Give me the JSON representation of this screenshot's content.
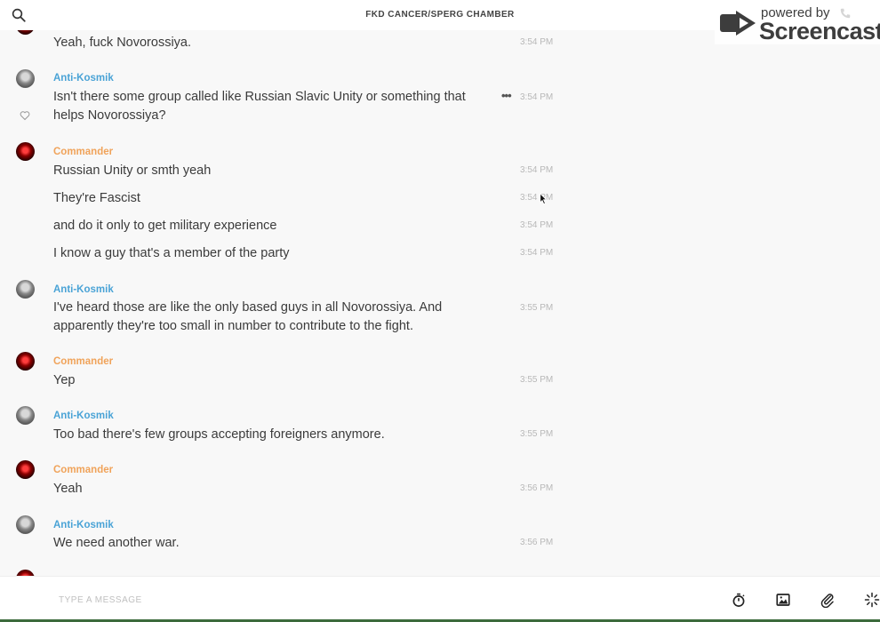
{
  "header": {
    "title": "FKD CANCER/SPERG CHAMBER"
  },
  "watermark": {
    "small": "powered by",
    "big": "Screencastify"
  },
  "colors": {
    "name_blue": "#4aa3d6",
    "name_orange": "#f0a35a"
  },
  "messages": [
    {
      "text": "Yeah, fuck Novorossiya.",
      "time": "3:54 PM"
    },
    {
      "author": "Anti-Kosmik",
      "text": "Isn't there some group called like Russian Slavic Unity or something that helps Novorossiya?",
      "time": "3:54 PM"
    },
    {
      "author": "Commander",
      "text": "Russian Unity or smth yeah",
      "time": "3:54 PM"
    },
    {
      "text": "They're Fascist",
      "time": "3:54 PM"
    },
    {
      "text": "and do it only to get military experience",
      "time": "3:54 PM"
    },
    {
      "text": "I know a guy that's a member of the party",
      "time": "3:54 PM"
    },
    {
      "author": "Anti-Kosmik",
      "text": "I've heard those are like the only based guys in all Novorossiya. And apparently they're too small in number to contribute to the fight.",
      "time": "3:55 PM"
    },
    {
      "author": "Commander",
      "text": "Yep",
      "time": "3:55 PM"
    },
    {
      "author": "Anti-Kosmik",
      "text": "Too bad there's few groups accepting foreigners anymore.",
      "time": "3:55 PM"
    },
    {
      "author": "Commander",
      "text": "Yeah",
      "time": "3:56 PM"
    },
    {
      "author": "Anti-Kosmik",
      "text": "We need another war.",
      "time": "3:56 PM"
    }
  ],
  "composer": {
    "placeholder": "TYPE A MESSAGE",
    "value": ""
  }
}
